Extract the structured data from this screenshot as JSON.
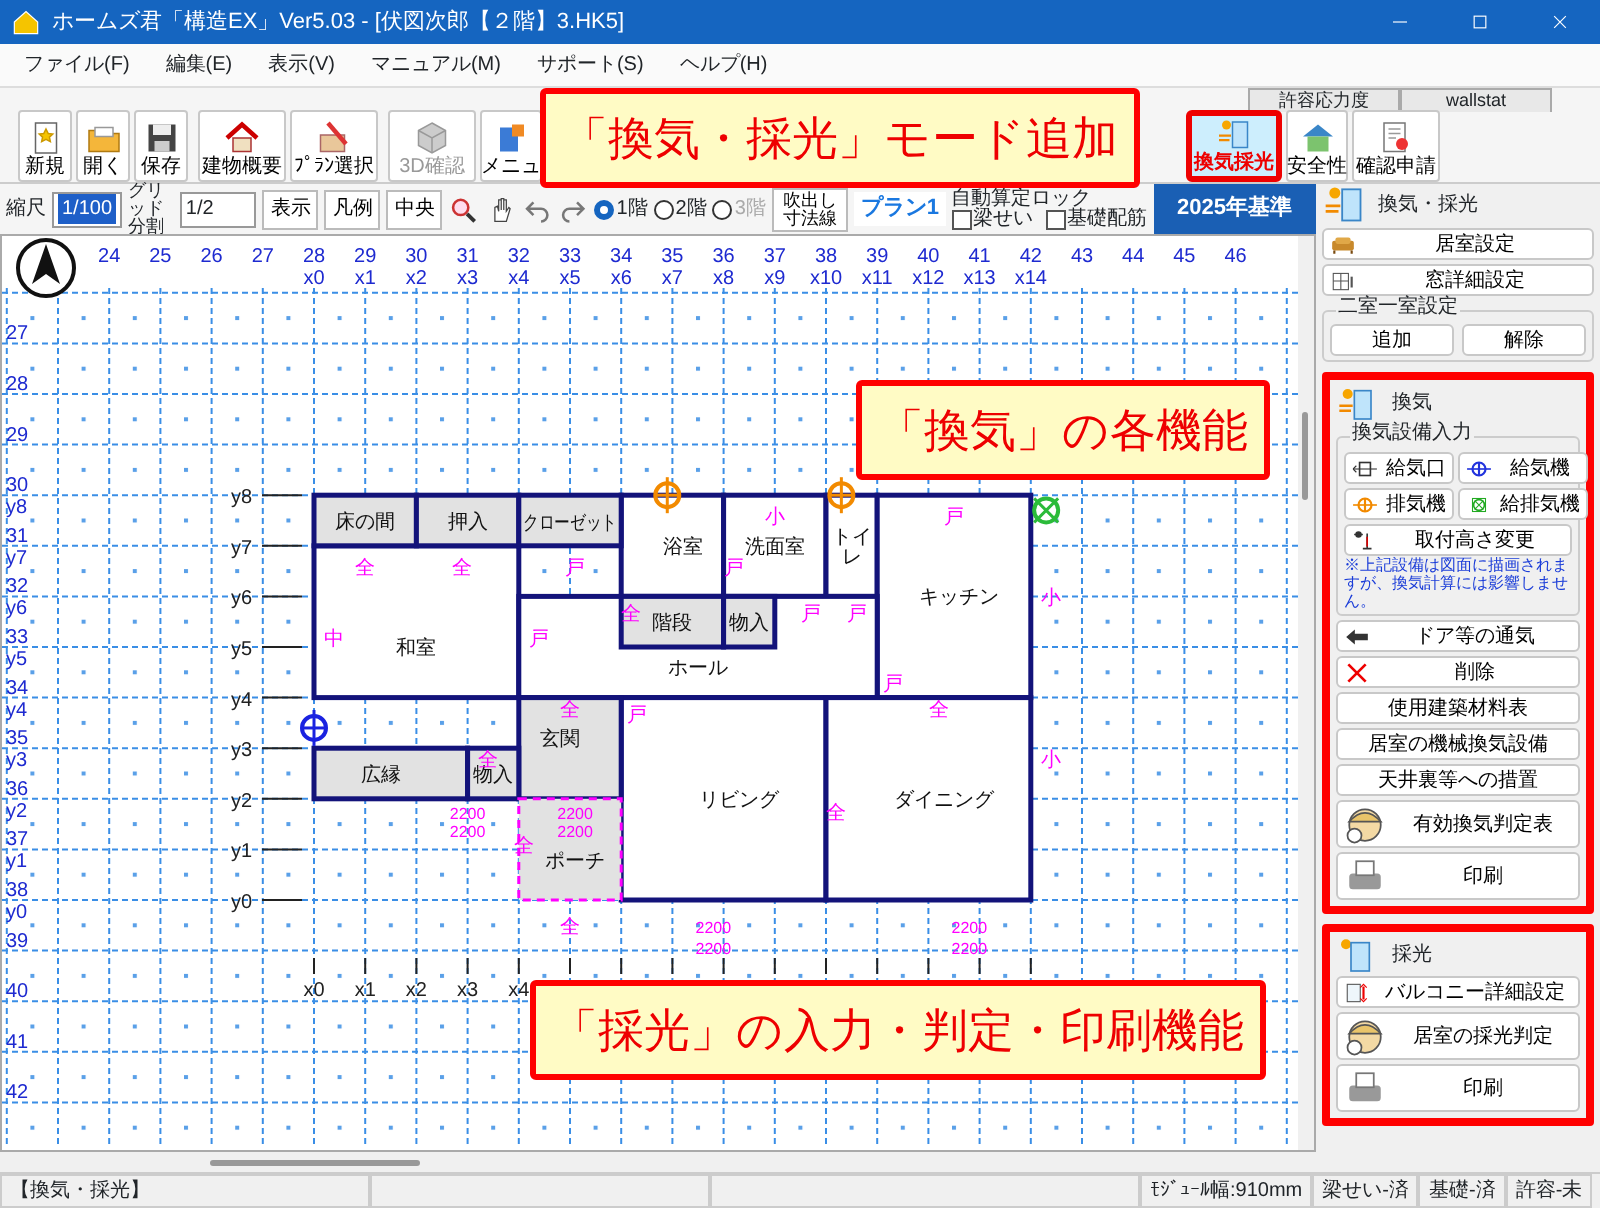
{
  "window": {
    "title": "ホームズ君「構造EX」Ver5.03 - [伏図次郎【２階】3.HK5]"
  },
  "menu": [
    "ファイル(F)",
    "編集(E)",
    "表示(V)",
    "マニュアル(M)",
    "サポート(S)",
    "ヘルプ(H)"
  ],
  "mode_tabs": [
    {
      "label": "許容応力度",
      "selected": false
    },
    {
      "label": "wallstat",
      "selected": false
    }
  ],
  "toolbar": [
    {
      "label": "新規",
      "disabled": false,
      "selected": false
    },
    {
      "label": "開く",
      "disabled": false,
      "selected": false
    },
    {
      "label": "保存",
      "disabled": false,
      "selected": false
    },
    {
      "label": "建物概要",
      "disabled": false,
      "selected": false
    },
    {
      "label": "ﾌﾟﾗﾝ選択",
      "disabled": false,
      "selected": false
    },
    {
      "label": "3D確認",
      "disabled": true,
      "selected": false
    },
    {
      "label": "メニュ",
      "disabled": false,
      "selected": false
    },
    {
      "label": "換気採光",
      "disabled": false,
      "selected": true
    },
    {
      "label": "安全性",
      "disabled": false,
      "selected": false
    },
    {
      "label": "確認申請",
      "disabled": false,
      "selected": false
    }
  ],
  "view_bar": {
    "scale_label": "縮尺",
    "scale": "1/100",
    "grid_label": "グリッド分割",
    "grid": "1/2",
    "buttons": [
      "表示",
      "凡例",
      "中央"
    ],
    "floors": [
      {
        "label": "1階",
        "selected": true,
        "disabled": false
      },
      {
        "label": "2階",
        "selected": false,
        "disabled": false
      },
      {
        "label": "3階",
        "selected": false,
        "disabled": true
      }
    ],
    "dim_button": "吹出し寸法線",
    "plan": "プラン1",
    "auto_label": "自動算定ロック",
    "checks": [
      {
        "label": "梁せい",
        "checked": false
      },
      {
        "label": "基礎配筋",
        "checked": false
      }
    ],
    "standard": "2025年基準"
  },
  "canvas": {
    "col_numbers": [
      "24",
      "25",
      "26",
      "27",
      "28",
      "29",
      "30",
      "31",
      "32",
      "33",
      "34",
      "35",
      "36",
      "37",
      "38",
      "39",
      "40",
      "41",
      "42",
      "43",
      "44",
      "45",
      "46"
    ],
    "x_labels": [
      "x0",
      "x1",
      "x2",
      "x3",
      "x4",
      "x5",
      "x6",
      "x7",
      "x8",
      "x9",
      "x10",
      "x11",
      "x12",
      "x13",
      "x14"
    ],
    "row_numbers": [
      "27",
      "28",
      "29",
      "30",
      "31",
      "32",
      "33",
      "34",
      "35",
      "36",
      "37",
      "38",
      "39",
      "40",
      "41",
      "42"
    ],
    "y_labels": [
      "y8",
      "y7",
      "y6",
      "y5",
      "y4",
      "y3",
      "y2",
      "y1",
      "y0"
    ],
    "axis_y": [
      "y8",
      "y7",
      "y6",
      "y5",
      "y4",
      "y3",
      "y2",
      "y1",
      "y0"
    ],
    "axis_x": [
      "x0",
      "x1",
      "x2",
      "x3",
      "x4"
    ],
    "rooms": [
      {
        "name": "床の間",
        "kind": "storage"
      },
      {
        "name": "押入",
        "kind": "storage"
      },
      {
        "name": "クローゼット",
        "kind": "storage"
      },
      {
        "name": "浴室",
        "kind": "room"
      },
      {
        "name": "洗面室",
        "kind": "room"
      },
      {
        "name": "トイレ",
        "kind": "room"
      },
      {
        "name": "キッチン",
        "kind": "room"
      },
      {
        "name": "階段",
        "kind": "storage"
      },
      {
        "name": "物入",
        "kind": "storage"
      },
      {
        "name": "和室",
        "kind": "room"
      },
      {
        "name": "ホール",
        "kind": "room"
      },
      {
        "name": "玄関",
        "kind": "storage"
      },
      {
        "name": "広縁",
        "kind": "storage"
      },
      {
        "name": "物入",
        "kind": "storage"
      },
      {
        "name": "リビング",
        "kind": "room"
      },
      {
        "name": "ダイニング",
        "kind": "room"
      },
      {
        "name": "ポーチ",
        "kind": "porch"
      }
    ],
    "marks": [
      "小",
      "戸",
      "全",
      "全",
      "戸",
      "戸",
      "小",
      "全",
      "戸",
      "戸",
      "中",
      "戸",
      "戸",
      "全",
      "戸",
      "全",
      "全",
      "小",
      "2200",
      "2200",
      "全",
      "2200",
      "2200",
      "全",
      "全",
      "2200",
      "2200",
      "2200",
      "2200"
    ]
  },
  "panel": {
    "title": "換気・採光",
    "top_buttons": [
      {
        "label": "居室設定"
      },
      {
        "label": "窓詳細設定"
      }
    ],
    "room_group": {
      "title": "二室一室設定",
      "buttons": [
        "追加",
        "解除"
      ]
    },
    "sections": [
      {
        "title": "換気",
        "highlighted": true,
        "group": {
          "title": "換気設備入力",
          "devices": [
            {
              "label": "給気口"
            },
            {
              "label": "給気機"
            },
            {
              "label": "排気機"
            },
            {
              "label": "給排気機"
            }
          ],
          "wide": {
            "label": "取付高さ変更"
          },
          "note": "※上記設備は図面に描画されますが、換気計算には影響しません。"
        },
        "buttons": [
          {
            "label": "ドア等の通気"
          },
          {
            "label": "削除"
          },
          {
            "label": "使用建築材料表"
          },
          {
            "label": "居室の機械換気設備"
          },
          {
            "label": "天井裏等への措置"
          },
          {
            "label": "有効換気判定表"
          },
          {
            "label": "印刷"
          }
        ]
      },
      {
        "title": "採光",
        "highlighted": true,
        "buttons": [
          {
            "label": "バルコニー詳細設定"
          },
          {
            "label": "居室の採光判定"
          },
          {
            "label": "印刷"
          }
        ]
      }
    ]
  },
  "callouts": [
    {
      "text": "「換気・採光」モード追加"
    },
    {
      "text": "「換気」の各機能"
    },
    {
      "text": "「採光」の入力・判定・印刷機能"
    }
  ],
  "status_bar": [
    {
      "text": "【換気・採光】"
    },
    {
      "text": "ﾓｼﾞｭｰﾙ幅:910mm"
    },
    {
      "text": "梁せい-済"
    },
    {
      "text": "基礎-済"
    },
    {
      "text": "許容-未"
    }
  ]
}
